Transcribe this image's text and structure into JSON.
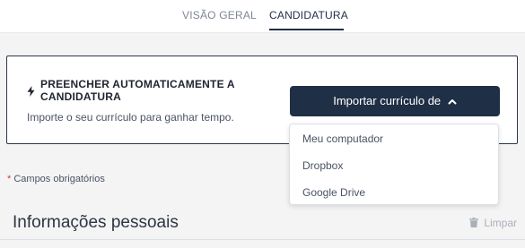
{
  "tabs": {
    "items": [
      {
        "label": "VISÃO GERAL",
        "active": false
      },
      {
        "label": "CANDIDATURA",
        "active": true
      }
    ]
  },
  "autofill": {
    "icon": "lightning-bolt-icon",
    "title": "PREENCHER AUTOMATICAMENTE A CANDIDATURA",
    "subtitle": "Importe o seu currículo para ganhar tempo.",
    "import_button_label": "Importar currículo de",
    "import_button_icon": "chevron-up-icon"
  },
  "import_menu": {
    "options": [
      "Meu computador",
      "Dropbox",
      "Google Drive"
    ]
  },
  "form": {
    "required_asterisk": "*",
    "required_note": "Campos obrigatórios",
    "section_title": "Informações pessoais",
    "clear_label": "Limpar",
    "clear_icon": "trash-icon"
  },
  "colors": {
    "primary": "#1f2f46",
    "required": "#d43c3c",
    "muted": "#aab0b8",
    "background": "#f4f4f4"
  }
}
